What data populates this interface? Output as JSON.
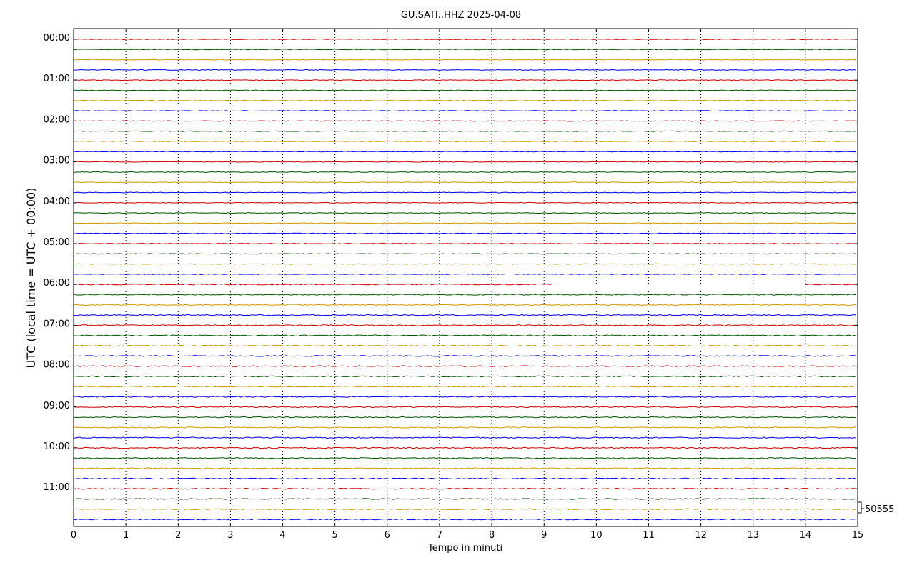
{
  "chart_data": {
    "type": "line",
    "title": "GU.SATI..HHZ 2025-04-08",
    "xlabel": "Tempo in minuti",
    "ylabel": "UTC (local time = UTC + 00:00)",
    "xlim": [
      0,
      15
    ],
    "x_ticks": [
      "0",
      "1",
      "2",
      "3",
      "4",
      "5",
      "6",
      "7",
      "8",
      "9",
      "10",
      "11",
      "12",
      "13",
      "14",
      "15"
    ],
    "y_ticks": [
      "00:00",
      "01:00",
      "02:00",
      "03:00",
      "04:00",
      "05:00",
      "06:00",
      "07:00",
      "08:00",
      "09:00",
      "10:00",
      "11:00"
    ],
    "rows_per_hour": 4,
    "row_count": 48,
    "trace_colors": [
      "#cc0000",
      "#005500",
      "#cc9900",
      "#0000ee"
    ],
    "scale_label": "50555",
    "gap": {
      "row_start": "06:00",
      "x_from": 9.18,
      "x_to": 14.0
    },
    "grid": "vertical dotted"
  }
}
